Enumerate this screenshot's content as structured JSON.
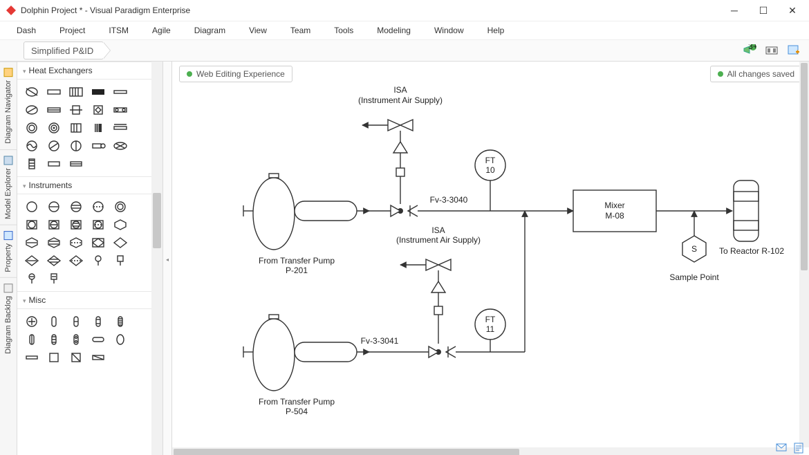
{
  "window": {
    "title": "Dolphin Project * - Visual Paradigm Enterprise"
  },
  "menu": [
    "Dash",
    "Project",
    "ITSM",
    "Agile",
    "Diagram",
    "View",
    "Team",
    "Tools",
    "Modeling",
    "Window",
    "Help"
  ],
  "breadcrumb": "Simplified P&ID",
  "left_tabs": [
    "Diagram Navigator",
    "Model Explorer",
    "Property",
    "Diagram Backlog"
  ],
  "palette": {
    "categories": [
      "Heat Exchangers",
      "Instruments",
      "Misc"
    ]
  },
  "status": {
    "editing": "Web Editing Experience",
    "save": "All changes saved"
  },
  "diagram": {
    "isa1": {
      "title": "ISA",
      "sub": "(Instrument Air Supply)"
    },
    "isa2": {
      "title": "ISA",
      "sub": "(Instrument Air Supply)"
    },
    "ft1": {
      "top": "FT",
      "bot": "10"
    },
    "ft2": {
      "top": "FT",
      "bot": "11"
    },
    "mixer": {
      "l1": "Mixer",
      "l2": "M-08"
    },
    "pump1": {
      "l1": "From Transfer Pump",
      "l2": "P-201"
    },
    "pump2": {
      "l1": "From Transfer Pump",
      "l2": "P-504"
    },
    "line1": "Fv-3-3040",
    "line2": "Fv-3-3041",
    "sample": "Sample Point",
    "sample_s": "S",
    "reactor": "To Reactor R-102"
  }
}
